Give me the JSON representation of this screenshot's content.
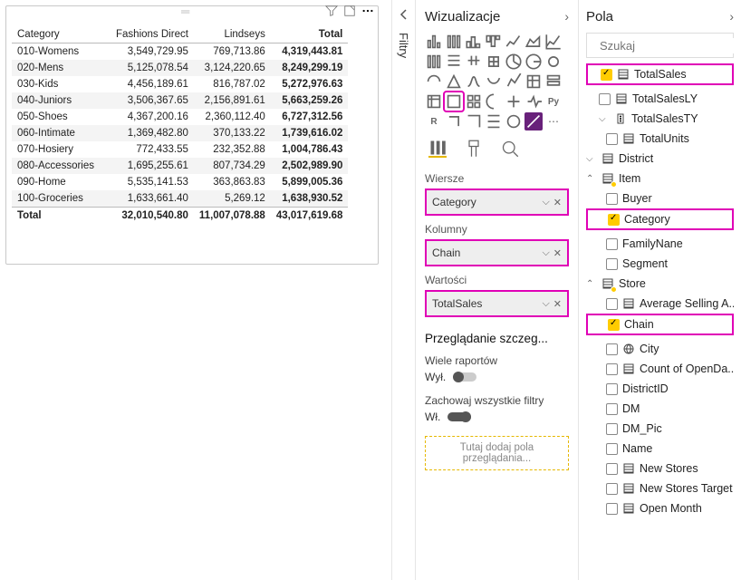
{
  "panes": {
    "viz_title": "Wizualizacje",
    "fields_title": "Pola",
    "filters_label": "Filtry"
  },
  "search": {
    "placeholder": "Szukaj"
  },
  "matrix": {
    "headers": [
      "Category",
      "Fashions Direct",
      "Lindseys",
      "Total"
    ],
    "rows": [
      [
        "010-Womens",
        "3,549,729.95",
        "769,713.86",
        "4,319,443.81"
      ],
      [
        "020-Mens",
        "5,125,078.54",
        "3,124,220.65",
        "8,249,299.19"
      ],
      [
        "030-Kids",
        "4,456,189.61",
        "816,787.02",
        "5,272,976.63"
      ],
      [
        "040-Juniors",
        "3,506,367.65",
        "2,156,891.61",
        "5,663,259.26"
      ],
      [
        "050-Shoes",
        "4,367,200.16",
        "2,360,112.40",
        "6,727,312.56"
      ],
      [
        "060-Intimate",
        "1,369,482.80",
        "370,133.22",
        "1,739,616.02"
      ],
      [
        "070-Hosiery",
        "772,433.55",
        "232,352.88",
        "1,004,786.43"
      ],
      [
        "080-Accessories",
        "1,695,255.61",
        "807,734.29",
        "2,502,989.90"
      ],
      [
        "090-Home",
        "5,535,141.53",
        "363,863.83",
        "5,899,005.36"
      ],
      [
        "100-Groceries",
        "1,633,661.40",
        "5,269.12",
        "1,638,930.52"
      ]
    ],
    "total": [
      "Total",
      "32,010,540.80",
      "11,007,078.88",
      "43,017,619.68"
    ]
  },
  "wells": {
    "rows_label": "Wiersze",
    "rows_value": "Category",
    "cols_label": "Kolumny",
    "cols_value": "Chain",
    "vals_label": "Wartości",
    "vals_value": "TotalSales"
  },
  "drill": {
    "header": "Przeglądanie szczeg...",
    "cross_label": "Wiele raportów",
    "cross_state": "Wył.",
    "keep_label": "Zachowaj wszystkie filtry",
    "keep_state": "Wł.",
    "hint": "Tutaj dodaj pola przeglądania..."
  },
  "fields": {
    "top": [
      {
        "name": "TotalSales",
        "checked": true,
        "icon": "table",
        "hl": true
      },
      {
        "name": "TotalSalesLY",
        "checked": false,
        "icon": "table"
      },
      {
        "name": "TotalSalesTY",
        "checked": false,
        "icon": "traffic",
        "expand": "v"
      },
      {
        "name": "TotalUnits",
        "checked": false,
        "icon": "table",
        "indent": true
      }
    ],
    "tables": [
      {
        "name": "District",
        "exp": "v",
        "items": []
      },
      {
        "name": "Item",
        "exp": "^",
        "badge": true,
        "items": [
          {
            "name": "Buyer",
            "checked": false
          },
          {
            "name": "Category",
            "checked": true,
            "hl": true
          },
          {
            "name": "FamilyNane",
            "checked": false
          },
          {
            "name": "Segment",
            "checked": false
          }
        ]
      },
      {
        "name": "Store",
        "exp": "^",
        "badge": true,
        "items": [
          {
            "name": "Average Selling A...",
            "checked": false,
            "icon": "table"
          },
          {
            "name": "Chain",
            "checked": true,
            "hl": true
          },
          {
            "name": "City",
            "checked": false,
            "icon": "globe"
          },
          {
            "name": "Count of OpenDa...",
            "checked": false,
            "icon": "table"
          },
          {
            "name": "DistrictID",
            "checked": false
          },
          {
            "name": "DM",
            "checked": false
          },
          {
            "name": "DM_Pic",
            "checked": false
          },
          {
            "name": "Name",
            "checked": false
          },
          {
            "name": "New Stores",
            "checked": false,
            "icon": "table"
          },
          {
            "name": "New Stores Target",
            "checked": false,
            "icon": "table"
          },
          {
            "name": "Open Month",
            "checked": false,
            "icon": "table"
          }
        ]
      }
    ]
  }
}
